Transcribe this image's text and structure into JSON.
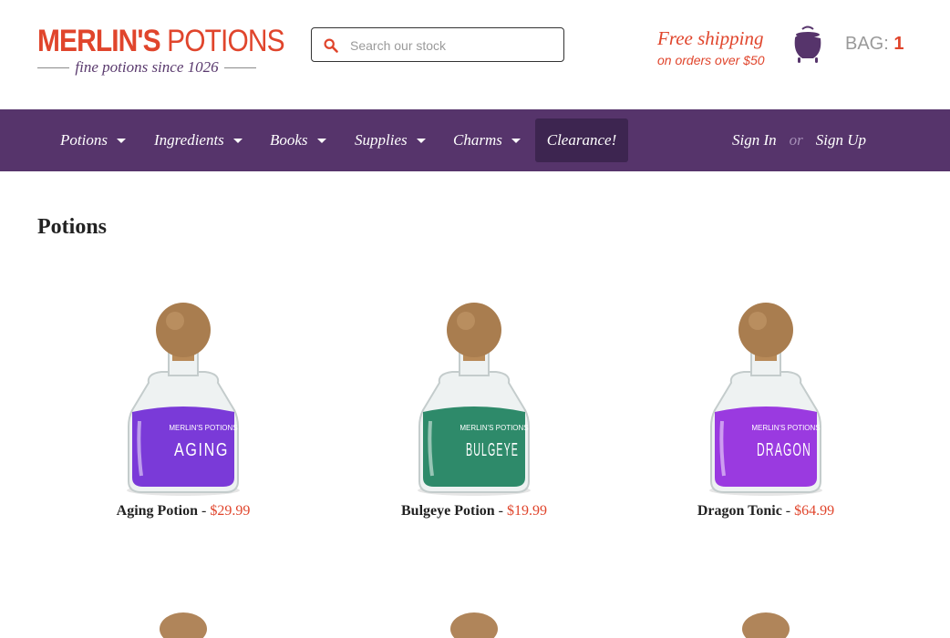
{
  "logo": {
    "name_left": "MERLIN'S",
    "name_right": "POTIONS",
    "tagline": "fine potions since 1026"
  },
  "search": {
    "placeholder": "Search our stock",
    "value": ""
  },
  "shipping": {
    "headline": "Free shipping",
    "detail": "on orders over $50"
  },
  "bag": {
    "label": "BAG:",
    "count": "1"
  },
  "nav": {
    "items": [
      {
        "label": "Potions"
      },
      {
        "label": "Ingredients"
      },
      {
        "label": "Books"
      },
      {
        "label": "Supplies"
      },
      {
        "label": "Charms"
      }
    ],
    "clearance": "Clearance!",
    "sign_in": "Sign In",
    "or": "or",
    "sign_up": "Sign Up"
  },
  "page_title": "Potions",
  "products": [
    {
      "name": "Aging Potion",
      "separator": " - ",
      "price": "$29.99",
      "label": "AGING",
      "color": "#7a3ad8"
    },
    {
      "name": "Bulgeye Potion",
      "separator": " - ",
      "price": "$19.99",
      "label": "BULGEYE",
      "color": "#2e8a6a"
    },
    {
      "name": "Dragon Tonic",
      "separator": " - ",
      "price": "$64.99",
      "label": "DRAGON",
      "color": "#9a3ae0"
    }
  ],
  "bottle_brand": "MERLIN'S POTIONS",
  "colors": {
    "accent": "#e0452c",
    "nav": "#56346b",
    "clearance": "#3d2550"
  }
}
